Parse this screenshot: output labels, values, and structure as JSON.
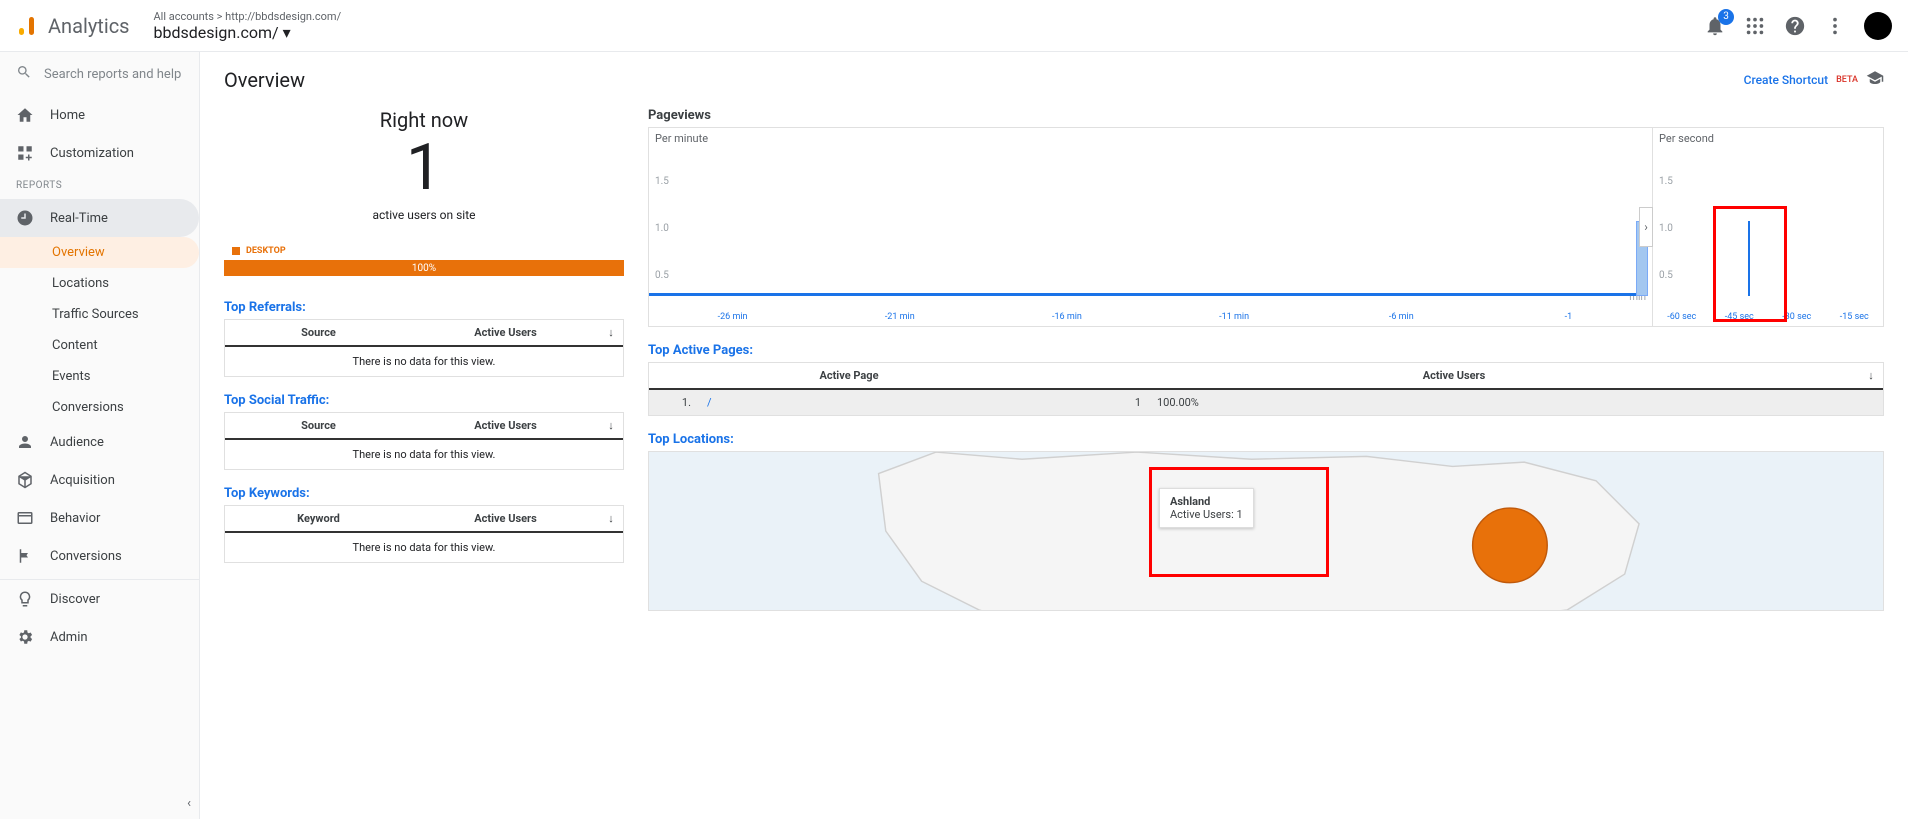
{
  "header": {
    "product": "Analytics",
    "breadcrumb": "All accounts > http://bbdsdesign.com/",
    "property": "bbdsdesign.com/",
    "notif_count": "3"
  },
  "search": {
    "placeholder": "Search reports and help"
  },
  "nav": {
    "home": "Home",
    "customization": "Customization",
    "reports_label": "REPORTS",
    "realtime": "Real-Time",
    "rt_sub": {
      "overview": "Overview",
      "locations": "Locations",
      "traffic": "Traffic Sources",
      "content": "Content",
      "events": "Events",
      "conversions": "Conversions"
    },
    "audience": "Audience",
    "acquisition": "Acquisition",
    "behavior": "Behavior",
    "conversions2": "Conversions",
    "discover": "Discover",
    "admin": "Admin"
  },
  "page": {
    "title": "Overview",
    "shortcut": "Create Shortcut",
    "beta": "BETA"
  },
  "right_now": {
    "title": "Right now",
    "count": "1",
    "sub": "active users on site",
    "device": "DESKTOP",
    "pct": "100%"
  },
  "referrals": {
    "title": "Top Referrals:",
    "col1": "Source",
    "col2": "Active Users",
    "empty": "There is no data for this view."
  },
  "social": {
    "title": "Top Social Traffic:",
    "col1": "Source",
    "col2": "Active Users",
    "empty": "There is no data for this view."
  },
  "keywords": {
    "title": "Top Keywords:",
    "col1": "Keyword",
    "col2": "Active Users",
    "empty": "There is no data for this view."
  },
  "pageviews": {
    "title": "Pageviews",
    "per_min": "Per minute",
    "per_sec": "Per second",
    "y_15": "1.5",
    "y_10": "1.0",
    "y_05": "0.5",
    "min_label": "min",
    "x_min": [
      "-26 min",
      "-21 min",
      "-16 min",
      "-11 min",
      "-6 min",
      "-1"
    ],
    "x_sec": [
      "-60 sec",
      "-45 sec",
      "-30 sec",
      "-15 sec"
    ]
  },
  "active_pages": {
    "title": "Top Active Pages:",
    "col1": "Active Page",
    "col2": "Active Users",
    "rows": [
      {
        "idx": "1.",
        "page": "/",
        "count": "1",
        "pct": "100.00%"
      }
    ]
  },
  "locations": {
    "title": "Top Locations:",
    "tooltip_city": "Ashland",
    "tooltip_line": "Active Users: 1"
  },
  "chart_data": {
    "type": "bar",
    "per_minute": {
      "categories": [
        "-26 min",
        "-21 min",
        "-16 min",
        "-11 min",
        "-6 min",
        "-1 min"
      ],
      "values": [
        0,
        0,
        0,
        0,
        0,
        1
      ],
      "ylim": [
        0,
        1.5
      ]
    },
    "per_second": {
      "categories": [
        "-60 sec",
        "-45 sec",
        "-30 sec",
        "-15 sec"
      ],
      "values": [
        0,
        1,
        0,
        0
      ],
      "ylim": [
        0,
        1.5
      ]
    }
  }
}
